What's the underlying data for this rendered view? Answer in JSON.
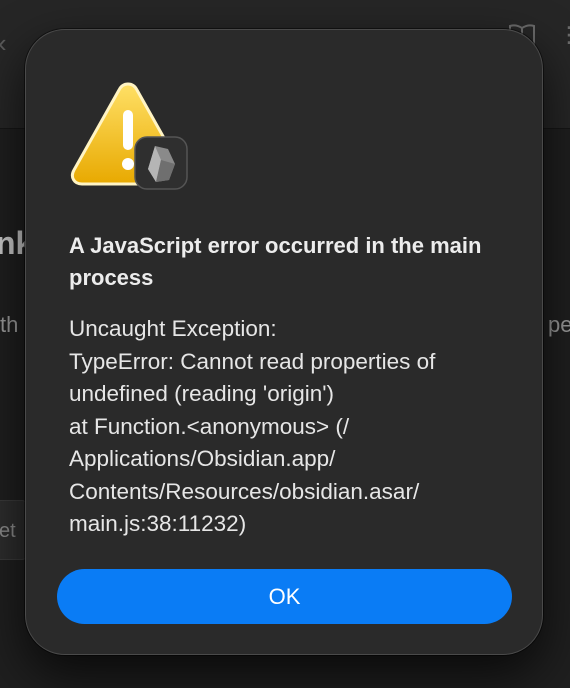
{
  "background": {
    "heading_fragment": "nk",
    "text_left_fragment": "th",
    "text_right_fragment": "pe",
    "button_fragment": "et"
  },
  "dialog": {
    "icon": "warning-triangle-icon",
    "badge_icon": "obsidian-app-icon",
    "title": "A JavaScript error occurred in the main process",
    "message": "Uncaught Exception:\nTypeError: Cannot read properties of undefined (reading 'origin')\nat Function.<anonymous> (/\nApplications/Obsidian.app/\nContents/Resources/obsidian.asar/\nmain.js:38:11232)",
    "ok_label": "OK"
  },
  "colors": {
    "dialog_background": "#2a2a2a",
    "button_accent": "#0a7cf5",
    "warning_yellow": "#f2c200"
  }
}
